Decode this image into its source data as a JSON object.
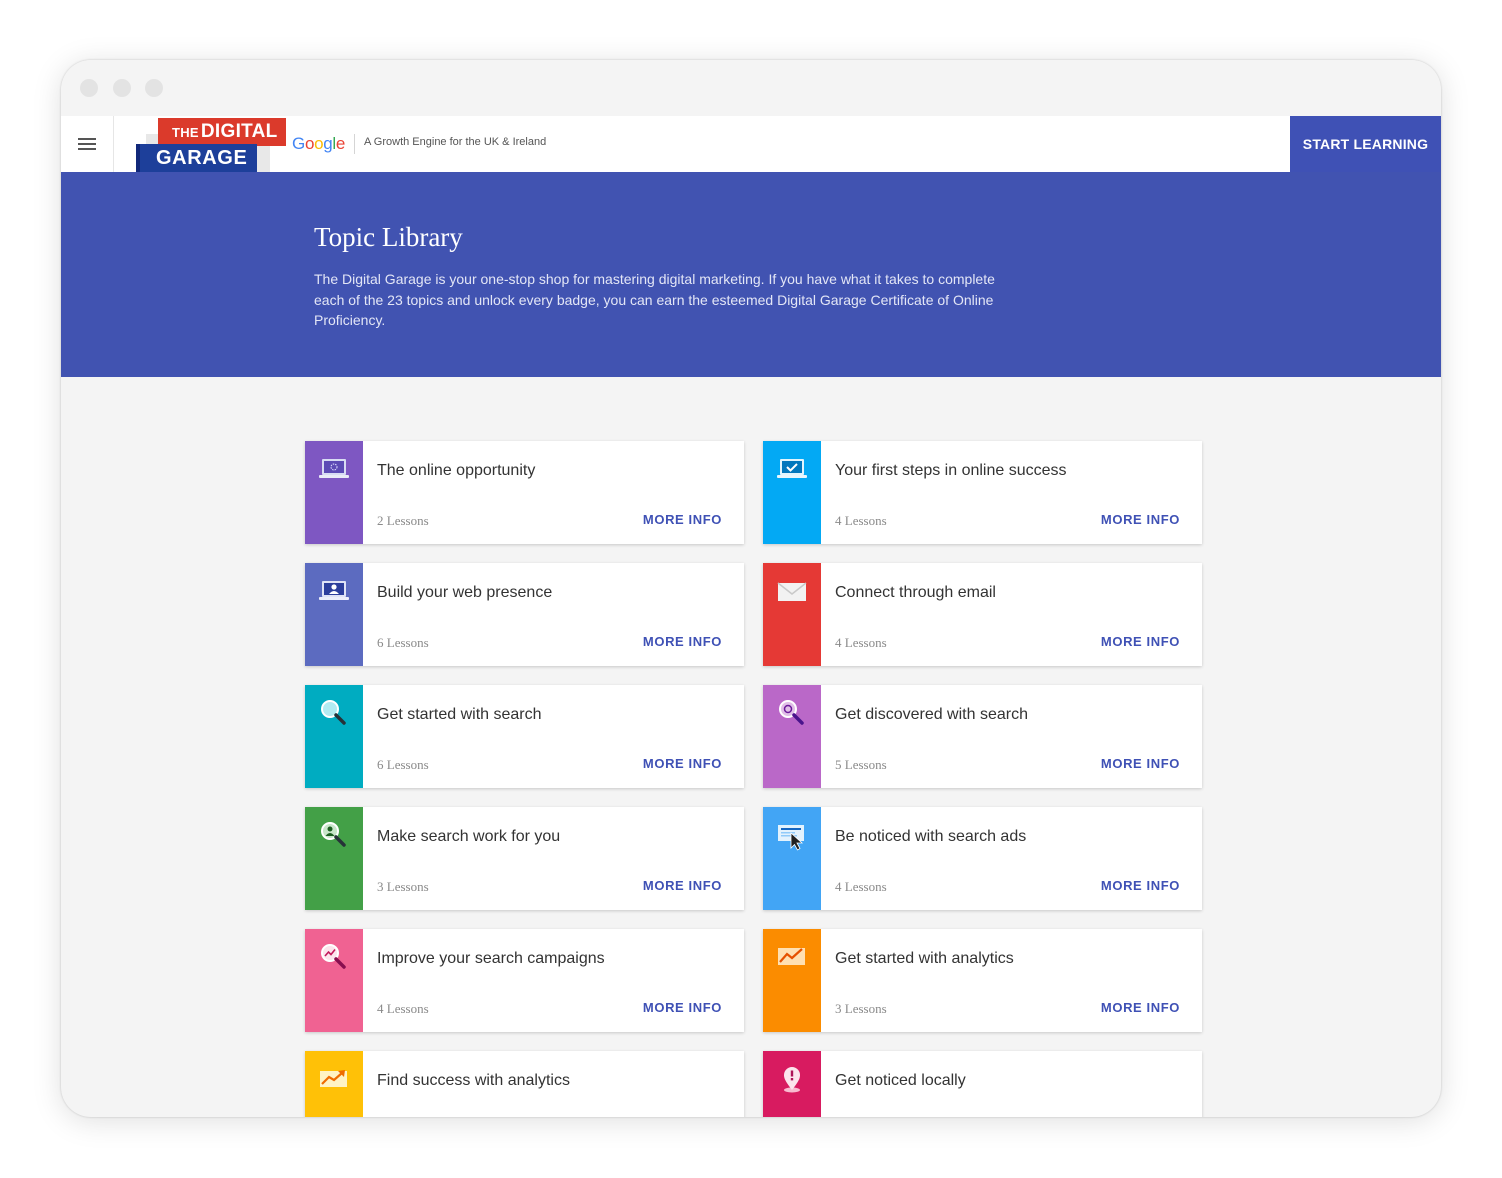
{
  "header": {
    "logo_top": "DIGITAL",
    "logo_the": "THE",
    "logo_bottom": "GARAGE",
    "google_letters": [
      "G",
      "o",
      "o",
      "g",
      "l",
      "e"
    ],
    "tagline": "A Growth Engine for the UK & Ireland",
    "start_label": "START LEARNING"
  },
  "hero": {
    "title": "Topic Library",
    "description": "The Digital Garage is your one-stop shop for mastering digital marketing. If you have what it takes to complete each of the 23 topics and unlock every badge, you can earn the esteemed Digital Garage Certificate of Online Proficiency."
  },
  "more_label": "MORE INFO",
  "topics": [
    {
      "title": "The online opportunity",
      "lessons": "2 Lessons",
      "color": "#7e57c2",
      "icon": "laptop-icon"
    },
    {
      "title": "Your first steps in online success",
      "lessons": "4 Lessons",
      "color": "#03a9f4",
      "icon": "laptop-check-icon"
    },
    {
      "title": "Build your web presence",
      "lessons": "6 Lessons",
      "color": "#5c6bc0",
      "icon": "laptop-user-icon"
    },
    {
      "title": "Connect through email",
      "lessons": "4 Lessons",
      "color": "#e53935",
      "icon": "envelope-icon"
    },
    {
      "title": "Get started with search",
      "lessons": "6 Lessons",
      "color": "#00acc1",
      "icon": "magnifier-icon"
    },
    {
      "title": "Get discovered with search",
      "lessons": "5 Lessons",
      "color": "#ba68c8",
      "icon": "magnifier-target-icon"
    },
    {
      "title": "Make search work for you",
      "lessons": "3 Lessons",
      "color": "#43a047",
      "icon": "magnifier-person-icon"
    },
    {
      "title": "Be noticed with search ads",
      "lessons": "4 Lessons",
      "color": "#42a5f5",
      "icon": "ad-cursor-icon"
    },
    {
      "title": "Improve your search campaigns",
      "lessons": "4 Lessons",
      "color": "#f06292",
      "icon": "magnifier-chart-icon"
    },
    {
      "title": "Get started with analytics",
      "lessons": "3 Lessons",
      "color": "#fb8c00",
      "icon": "trend-chart-icon"
    },
    {
      "title": "Find success with analytics",
      "lessons": "",
      "color": "#ffc107",
      "icon": "trend-arrow-icon"
    },
    {
      "title": "Get noticed locally",
      "lessons": "",
      "color": "#d81b60",
      "icon": "map-pin-icon"
    }
  ]
}
